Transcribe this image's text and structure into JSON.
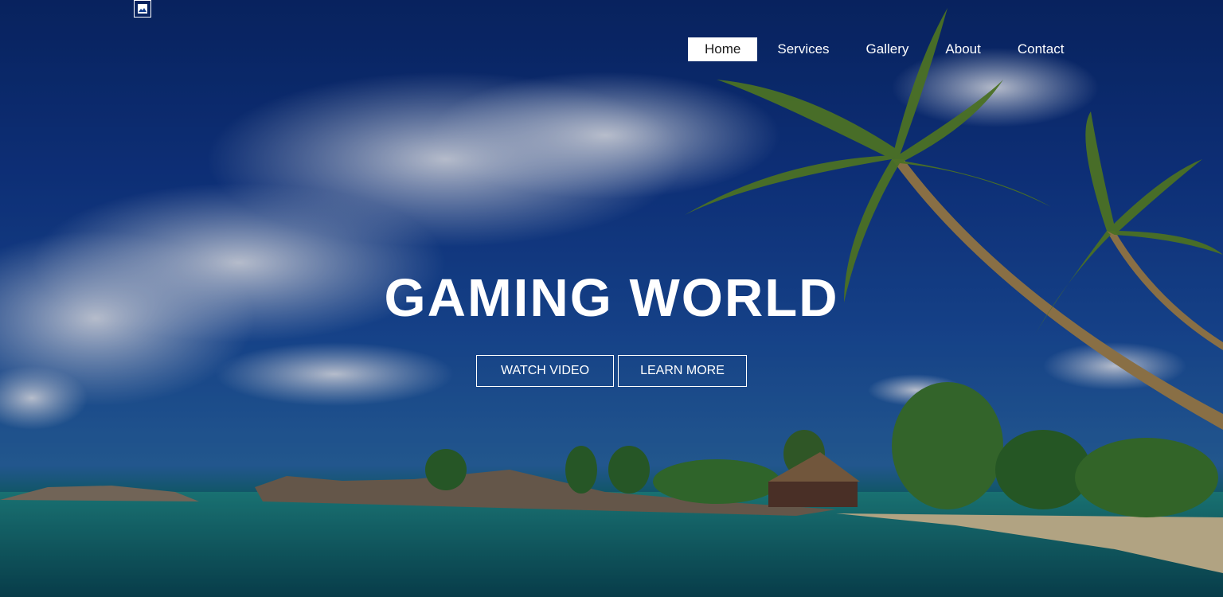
{
  "nav": {
    "items": [
      {
        "label": "Home",
        "active": true
      },
      {
        "label": "Services",
        "active": false
      },
      {
        "label": "Gallery",
        "active": false
      },
      {
        "label": "About",
        "active": false
      },
      {
        "label": "Contact",
        "active": false
      }
    ]
  },
  "hero": {
    "title": "GAMING WORLD",
    "buttons": {
      "watch": "WATCH VIDEO",
      "learn": "LEARN MORE"
    }
  },
  "icons": {
    "logo": "logo-icon"
  },
  "colors": {
    "sky": "#0f3a8a",
    "sea": "#0c6f68",
    "text": "#ffffff",
    "active_nav_bg": "#ffffff"
  }
}
